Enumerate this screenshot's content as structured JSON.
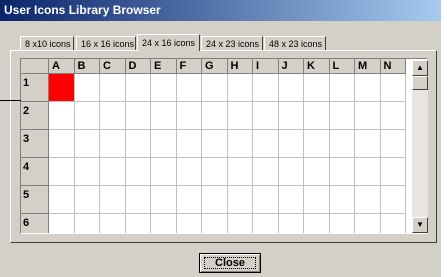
{
  "window": {
    "title": "User Icons Library Browser"
  },
  "tabs": [
    {
      "label": "8 x10 icons",
      "active": false
    },
    {
      "label": "16 x 16 icons",
      "active": false
    },
    {
      "label": "24 x 16 icons",
      "active": true
    },
    {
      "label": "24 x 23 icons",
      "active": false
    },
    {
      "label": "48 x 23 icons",
      "active": false
    }
  ],
  "grid": {
    "columns": [
      "A",
      "B",
      "C",
      "D",
      "E",
      "F",
      "G",
      "H",
      "I",
      "J",
      "K",
      "L",
      "M",
      "N"
    ],
    "rows": [
      "1",
      "2",
      "3",
      "4",
      "5",
      "6"
    ],
    "filled_cell": {
      "row": "1",
      "column": "A",
      "color": "#ff0000"
    }
  },
  "scrollbar": {
    "up_icon": "arrow-up-icon",
    "down_icon": "arrow-down-icon"
  },
  "buttons": {
    "close_label": "Close"
  }
}
